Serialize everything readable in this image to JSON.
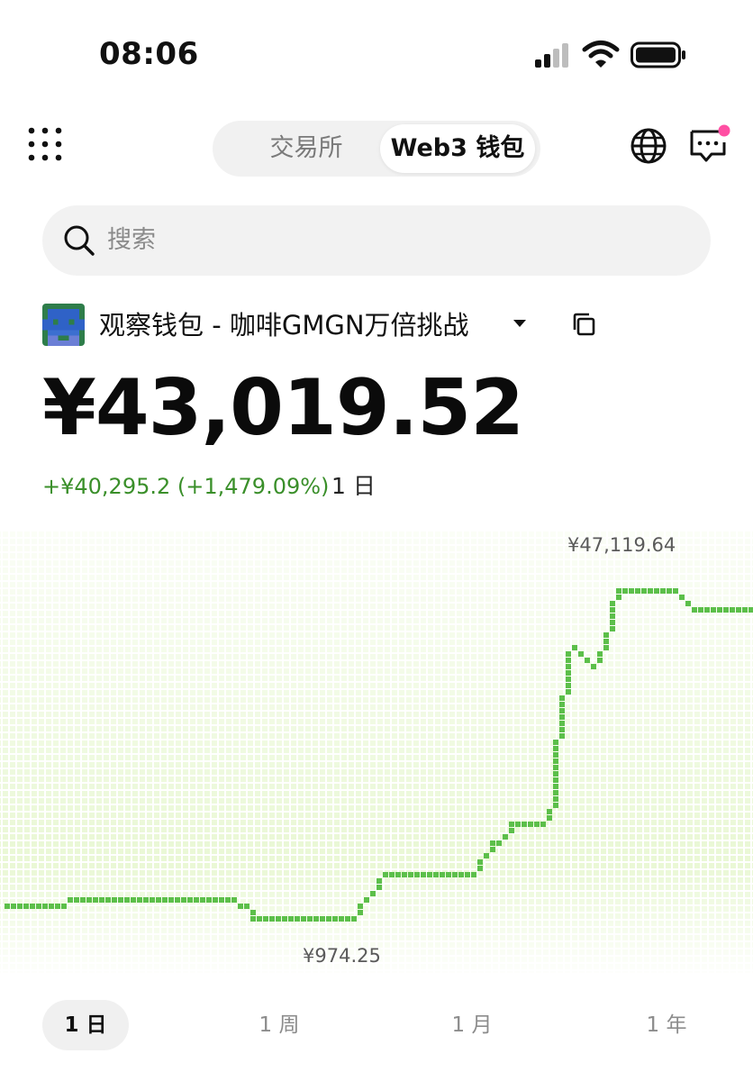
{
  "status_bar": {
    "time": "08:06",
    "icons": [
      "signal-icon",
      "wifi-icon",
      "battery-icon"
    ]
  },
  "header": {
    "menu_icon": "grid-dots-icon",
    "tabs": [
      {
        "label": "交易所",
        "active": false
      },
      {
        "label": "Web3 钱包",
        "active": true
      }
    ],
    "right_icons": [
      "globe-icon",
      "message-icon"
    ],
    "notification_dot_color": "#ff4fa3"
  },
  "search": {
    "placeholder": "搜索",
    "icon": "search-icon"
  },
  "wallet": {
    "name": "观察钱包 - 咖啡GMGN万倍挑战",
    "avatar_icon": "pixel-avatar-icon",
    "dropdown_icon": "caret-down-icon",
    "copy_icon": "copy-icon"
  },
  "balance": {
    "value": "¥43,019.52",
    "change": "+¥40,295.2 (+1,479.09%)",
    "period": "1 日"
  },
  "chart": {
    "max_label": "¥47,119.64",
    "min_label": "¥974.25",
    "line_color": "#5cbf4a",
    "grid_color": "#c9f0a0"
  },
  "chart_data": {
    "type": "line",
    "title": "",
    "xlabel": "",
    "ylabel": "",
    "x": [
      0,
      1,
      2,
      3,
      4,
      5,
      6,
      7,
      8,
      9,
      10,
      11,
      12,
      13,
      14,
      15,
      16,
      17,
      18,
      19,
      20,
      21,
      22,
      23,
      24,
      25,
      26,
      27,
      28,
      29,
      30,
      31,
      32,
      33,
      34,
      35,
      36,
      37,
      38,
      39,
      40,
      41,
      42,
      43,
      44,
      45,
      46,
      47,
      48,
      49,
      50,
      51,
      52,
      53,
      54,
      55,
      56,
      57,
      58,
      59,
      60,
      61,
      62,
      63,
      64,
      65,
      66,
      67,
      68,
      69,
      70,
      71,
      72,
      73,
      74,
      75,
      76,
      77,
      78,
      79,
      80,
      81,
      82,
      83,
      84,
      85,
      86,
      87,
      88,
      89,
      90,
      91,
      92,
      93,
      94,
      95,
      96,
      97,
      98,
      99,
      100,
      101,
      102,
      103,
      104,
      105,
      106,
      107,
      108,
      109,
      110,
      111,
      112,
      113,
      114,
      115,
      116,
      117,
      118,
      119,
      120
    ],
    "series": [
      {
        "values": [
          2700,
          2700,
          2700,
          2700,
          2700,
          2700,
          2700,
          2700,
          2700,
          2700,
          4000,
          4000,
          4000,
          4000,
          4000,
          4000,
          4000,
          4000,
          4000,
          4000,
          4000,
          4000,
          4000,
          4000,
          4000,
          4000,
          4000,
          4000,
          4000,
          4000,
          4000,
          4000,
          4000,
          4000,
          4000,
          4000,
          4000,
          2700,
          2700,
          1300,
          974,
          974,
          974,
          974,
          974,
          974,
          974,
          974,
          974,
          974,
          974,
          974,
          974,
          974,
          974,
          1300,
          2700,
          4000,
          5300,
          6600,
          7900,
          7900,
          7900,
          7900,
          7900,
          7900,
          7900,
          7900,
          7900,
          7900,
          7900,
          7900,
          7900,
          7900,
          7900,
          9200,
          10500,
          11800,
          11800,
          13100,
          14400,
          14400,
          14400,
          14400,
          14400,
          14400,
          16000,
          26000,
          32000,
          38000,
          39200,
          38300,
          37500,
          36500,
          38200,
          41000,
          45000,
          47119,
          47119,
          47119,
          47119,
          47119,
          47119,
          47119,
          47119,
          47119,
          47119,
          46500,
          45200,
          44400,
          44400,
          44400,
          44400,
          44400,
          44400,
          44400,
          44400,
          44400,
          44400,
          44900,
          45500
        ]
      }
    ],
    "ylim": [
      974.25,
      47119.64
    ]
  },
  "range_tabs": [
    {
      "label": "1 日",
      "active": true
    },
    {
      "label": "1 周",
      "active": false
    },
    {
      "label": "1 月",
      "active": false
    },
    {
      "label": "1 年",
      "active": false
    }
  ]
}
